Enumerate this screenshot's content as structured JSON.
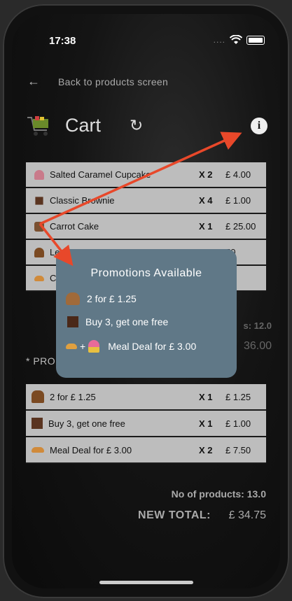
{
  "status_bar": {
    "time": "17:38",
    "dots": "...."
  },
  "nav": {
    "back_label": "Back to products screen"
  },
  "header": {
    "title": "Cart"
  },
  "cart_items": [
    {
      "name": "Salted Caramel Cupcake",
      "qty": "X 2",
      "price": "£ 4.00",
      "icon": "cupcake-icon",
      "color": "#c97a8a"
    },
    {
      "name": "Classic Brownie",
      "qty": "X 4",
      "price": "£ 1.00",
      "icon": "brownie-icon",
      "color": "#5a3420"
    },
    {
      "name": "Carrot Cake",
      "qty": "X 1",
      "price": "£ 25.00",
      "icon": "cake-icon",
      "color": "#7a5030"
    },
    {
      "name": "Le",
      "qty": "",
      "price": "50",
      "icon": "muffin-icon",
      "color": "#7b4a22"
    },
    {
      "name": "C",
      "qty": "",
      "price": "50",
      "icon": "croissant-icon",
      "color": "#d08a3a"
    }
  ],
  "partial_totals": {
    "products": "s: 12.0",
    "total": "36.00"
  },
  "promotions_section": {
    "label": "* PRO"
  },
  "promo_items": [
    {
      "name": "2 for £ 1.25",
      "qty": "X 1",
      "price": "£ 1.25",
      "icon": "muffin-icon",
      "color": "#7b4a22"
    },
    {
      "name": "Buy 3, get one free",
      "qty": "X 1",
      "price": "£ 1.00",
      "icon": "brownie-icon",
      "color": "#5a3420"
    },
    {
      "name": "Meal Deal for £ 3.00",
      "qty": "X 2",
      "price": "£ 7.50",
      "icon": "croissant-icon",
      "color": "#d08a3a"
    }
  ],
  "summary": {
    "products_count": "No of products: 13.0",
    "new_total_label": "NEW TOTAL:",
    "new_total_value": "£ 34.75"
  },
  "popup": {
    "title": "Promotions Available",
    "items": [
      {
        "text": "2 for £ 1.25",
        "icon": "muffin-icon"
      },
      {
        "text": "Buy 3, get one free",
        "icon": "brownie-icon"
      },
      {
        "text": "Meal Deal for £ 3.00",
        "icon": "croissant-plus-cupcake-icon",
        "plus": "+"
      }
    ]
  },
  "colors": {
    "popup_bg": "#607887",
    "row_bg": "#bdbdbd",
    "arrow": "#e8482a"
  }
}
